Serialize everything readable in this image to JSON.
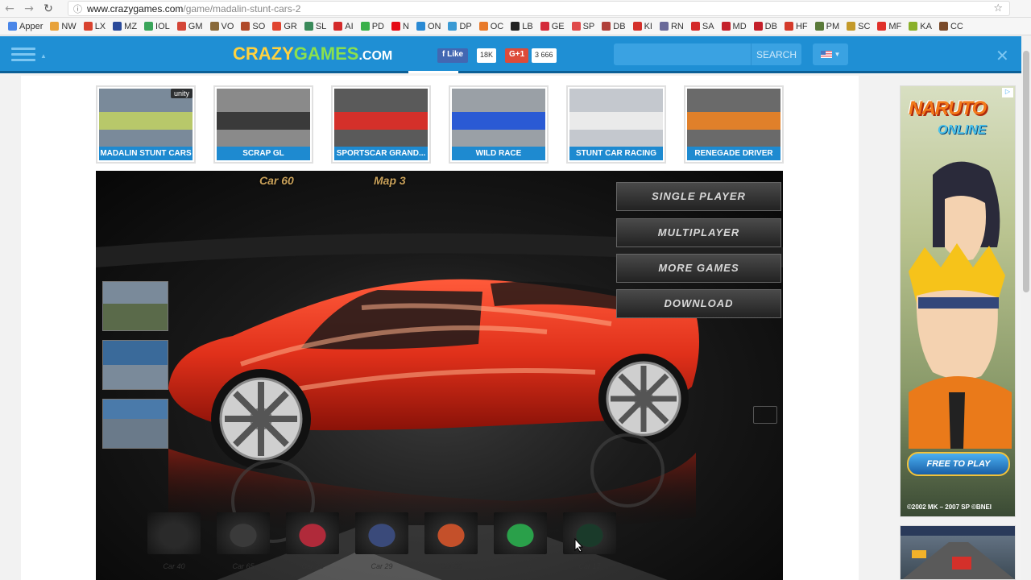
{
  "browser": {
    "url_domain": "www.crazygames.com",
    "url_path": "/game/madalin-stunt-cars-2",
    "bookmarks": [
      {
        "label": "Apper",
        "color": "#4a86e8"
      },
      {
        "label": "NW",
        "color": "#e8a23a"
      },
      {
        "label": "LX",
        "color": "#d9432f"
      },
      {
        "label": "MZ",
        "color": "#2a4a9a"
      },
      {
        "label": "IOL",
        "color": "#3aa55a"
      },
      {
        "label": "GM",
        "color": "#d44638"
      },
      {
        "label": "VO",
        "color": "#8a6a3a"
      },
      {
        "label": "SO",
        "color": "#b04a2a"
      },
      {
        "label": "GR",
        "color": "#e0442f"
      },
      {
        "label": "SL",
        "color": "#3a8a5a"
      },
      {
        "label": "AI",
        "color": "#d42a2a"
      },
      {
        "label": "PD",
        "color": "#3ab04a"
      },
      {
        "label": "N",
        "color": "#e50914"
      },
      {
        "label": "ON",
        "color": "#2a8ad4"
      },
      {
        "label": "DP",
        "color": "#3a9ad4"
      },
      {
        "label": "OC",
        "color": "#e87a2a"
      },
      {
        "label": "LB",
        "color": "#222222"
      },
      {
        "label": "GE",
        "color": "#d42a3a"
      },
      {
        "label": "SP",
        "color": "#e04a4a"
      },
      {
        "label": "DB",
        "color": "#b0403a"
      },
      {
        "label": "KI",
        "color": "#d4302a"
      },
      {
        "label": "RN",
        "color": "#6a6a9a"
      },
      {
        "label": "SA",
        "color": "#d42a2a"
      },
      {
        "label": "MD",
        "color": "#c4202a"
      },
      {
        "label": "DB",
        "color": "#c4202a"
      },
      {
        "label": "HF",
        "color": "#d43a2a"
      },
      {
        "label": "PM",
        "color": "#5a7a3a"
      },
      {
        "label": "SC",
        "color": "#c49a2a"
      },
      {
        "label": "MF",
        "color": "#e0302a"
      },
      {
        "label": "KA",
        "color": "#8ab02a"
      },
      {
        "label": "CC",
        "color": "#7a4a2a"
      }
    ]
  },
  "header": {
    "logo_part1": "CRAZY",
    "logo_part2": "GAMES",
    "logo_suffix": ".COM",
    "fb_like": "Like",
    "fb_count": "18K",
    "gplus": "G+1",
    "gplus_count": "3 666",
    "search_button": "SEARCH",
    "search_value": ""
  },
  "thumbnails": [
    {
      "label": "MADALIN STUNT CARS",
      "colors": [
        "#7a8a9a",
        "#b8c86a"
      ],
      "badge": "unity"
    },
    {
      "label": "SCRAP GL",
      "colors": [
        "#8a8a8a",
        "#3a3a3a"
      ]
    },
    {
      "label": "SPORTSCAR GRAND...",
      "colors": [
        "#5a5a5a",
        "#d4302a"
      ]
    },
    {
      "label": "WILD RACE",
      "colors": [
        "#9aa0a6",
        "#2a5ad4"
      ]
    },
    {
      "label": "STUNT CAR RACING",
      "colors": [
        "#c4c8ce",
        "#eaeaea"
      ]
    },
    {
      "label": "RENEGADE DRIVER",
      "colors": [
        "#6a6a6a",
        "#e0802a"
      ]
    }
  ],
  "game": {
    "car_label": "Car 60",
    "map_label": "Map 3",
    "menu": [
      {
        "label": "SINGLE PLAYER"
      },
      {
        "label": "MULTIPLAYER"
      },
      {
        "label": "MORE GAMES"
      },
      {
        "label": "DOWNLOAD"
      }
    ],
    "car_thumbs": [
      {
        "label": "Car 40",
        "color": "#2a2a2a"
      },
      {
        "label": "Car 65",
        "color": "#3a3a3a"
      },
      {
        "label": "Car 21",
        "color": "#b02a3a"
      },
      {
        "label": "Car 29",
        "color": "#3a4a7a"
      },
      {
        "label": "Car 55",
        "color": "#c4502a"
      },
      {
        "label": "Car 64",
        "color": "#2aa04a"
      },
      {
        "label": "Car 17",
        "color": "#1a3a2a"
      }
    ]
  },
  "ads": {
    "title": "NARUTO",
    "subtitle": "ONLINE",
    "button": "FREE TO PLAY",
    "copyright": "©2002 MK – 2007 SP   ©BNEI"
  }
}
